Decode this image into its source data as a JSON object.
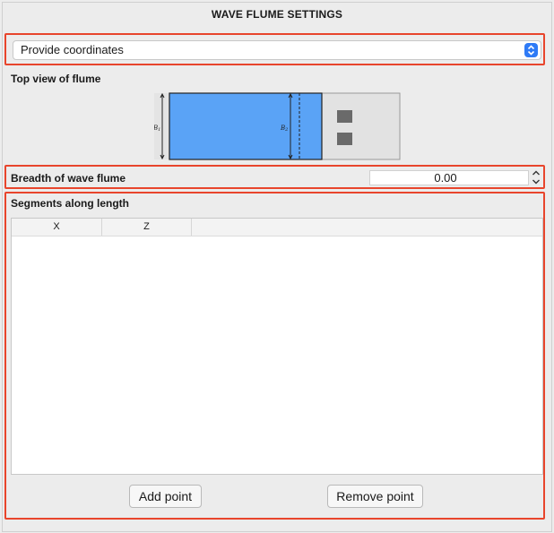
{
  "header": {
    "title": "WAVE FLUME SETTINGS"
  },
  "mode_select": {
    "value": "Provide coordinates"
  },
  "top_view": {
    "label": "Top view of flume",
    "label_b1": "B",
    "sub_b1": "1",
    "label_b2": "B",
    "sub_b2": "2"
  },
  "breadth": {
    "label": "Breadth of wave flume",
    "value": "0.00"
  },
  "segments": {
    "label": "Segments along length",
    "columns": [
      "X",
      "Z"
    ],
    "rows": []
  },
  "buttons": {
    "add_point": "Add point",
    "remove_point": "Remove point"
  },
  "colors": {
    "highlight": "#e8452c",
    "flume_water": "#5aa3f6",
    "accent": "#2f7bf6"
  }
}
